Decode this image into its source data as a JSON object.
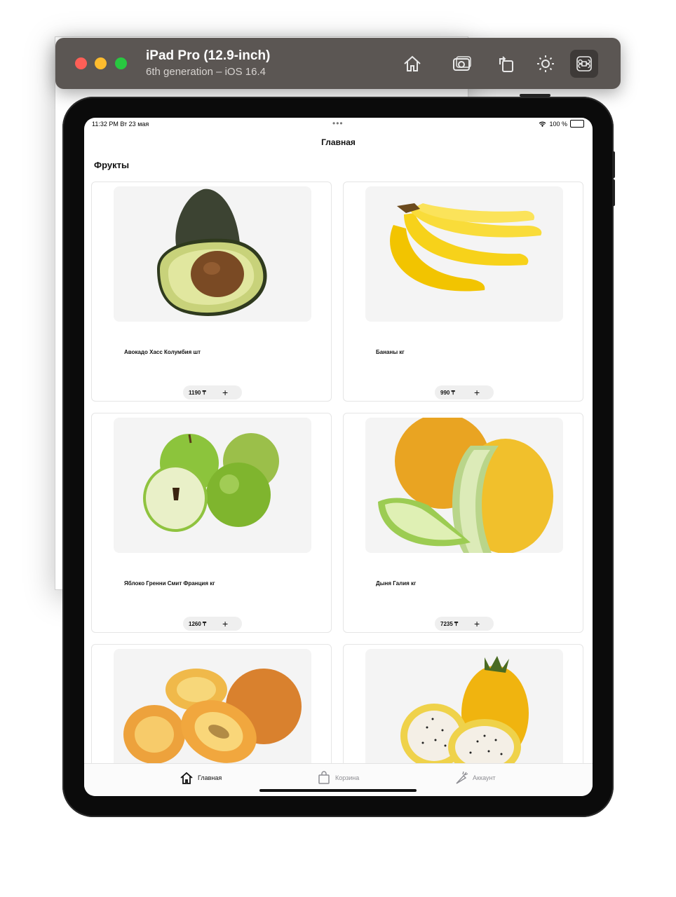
{
  "simulator": {
    "title": "iPad Pro (12.9-inch)",
    "subtitle": "6th generation – iOS 16.4",
    "toolbar_icons": [
      "home-icon",
      "screenshot-icon",
      "rotate-icon",
      "appearance-icon",
      "command-icon"
    ]
  },
  "status_bar": {
    "time": "11:32 PM   Вт 23 мая",
    "battery": "100 %"
  },
  "nav": {
    "title": "Главная"
  },
  "section": {
    "title": "Фрукты"
  },
  "products": [
    {
      "name": "Авокадо Хасс Колумбия шт",
      "price": "1190 ₸",
      "image": "avocado"
    },
    {
      "name": "Бананы кг",
      "price": "990 ₸",
      "image": "banana"
    },
    {
      "name": "Яблоко Гренни Смит Франция кг",
      "price": "1260 ₸",
      "image": "apple"
    },
    {
      "name": "Дыня Галия кг",
      "price": "7235 ₸",
      "image": "melon"
    },
    {
      "name": "",
      "price": "",
      "image": "kiwi"
    },
    {
      "name": "",
      "price": "",
      "image": "pitahaya"
    }
  ],
  "tabbar": {
    "home": "Главная",
    "cart": "Корзина",
    "account": "Аккаунт"
  },
  "colors": {
    "active_tab": "#111111",
    "inactive_tab": "#8e8e93",
    "card_border": "#e5e5e5",
    "image_bg": "#f4f4f4"
  }
}
